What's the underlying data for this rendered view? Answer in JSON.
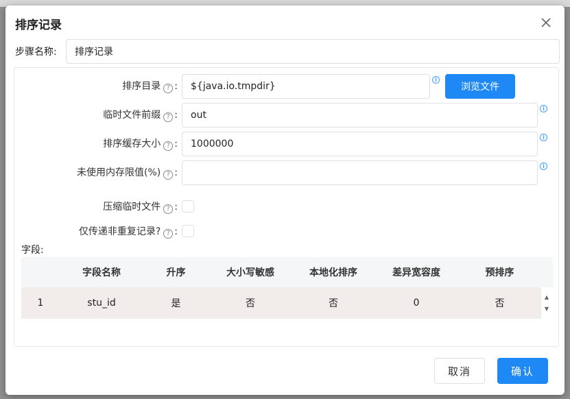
{
  "dialog": {
    "title": "排序记录",
    "step_name_label": "步骤名称:",
    "step_name_value": "排序记录"
  },
  "form": {
    "sort_dir": {
      "label": "排序目录",
      "value": "${java.io.tmpdir}"
    },
    "browse_label": "浏览文件",
    "temp_prefix": {
      "label": "临时文件前缀",
      "value": "out"
    },
    "sort_buffer": {
      "label": "排序缓存大小",
      "value": "1000000"
    },
    "free_memory": {
      "label": "未使用内存限值(%)",
      "value": ""
    },
    "compress_temp": {
      "label": "压缩临时文件",
      "checked": false
    },
    "unique_only": {
      "label": "仅传递非重复记录?",
      "checked": false
    },
    "help_glyph": "?",
    "colon": ":"
  },
  "fields": {
    "label": "字段:",
    "columns": [
      "",
      "字段名称",
      "升序",
      "大小写敏感",
      "本地化排序",
      "差异宽容度",
      "预排序"
    ],
    "rows": [
      [
        "1",
        "stu_id",
        "是",
        "否",
        "否",
        "0",
        "否"
      ]
    ]
  },
  "footer": {
    "cancel_label": "取消",
    "ok_label": "确认"
  },
  "colors": {
    "primary": "#1e88f5",
    "row_bg": "#f2ecea",
    "header_bg": "#f5f6f7"
  },
  "icons": [
    "close-icon",
    "help-icon",
    "info-icon",
    "scroll-up-icon",
    "scroll-down-icon"
  ]
}
